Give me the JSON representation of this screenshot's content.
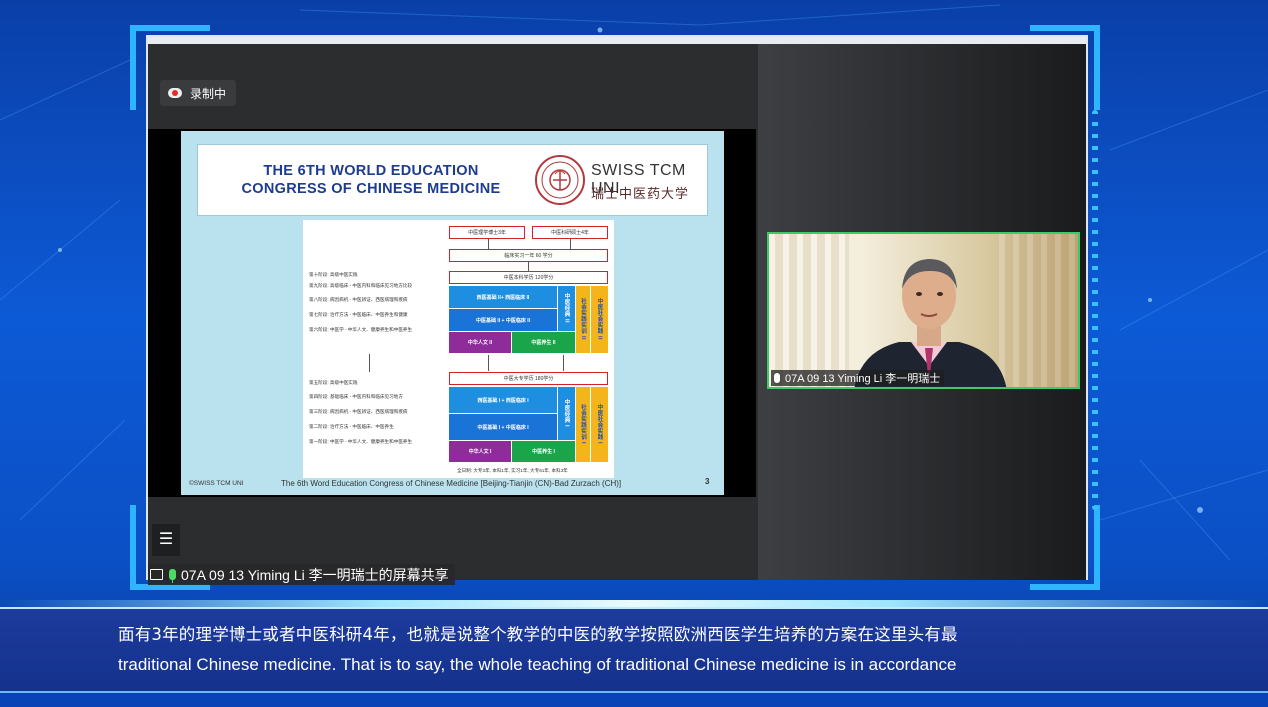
{
  "recording": {
    "label": "录制中"
  },
  "slide": {
    "title_line1": "THE 6TH WORLD EDUCATION",
    "title_line2": "CONGRESS OF CHINESE MEDICINE",
    "brand_en": "SWISS TCM UNI",
    "brand_cn": "瑞士中医药大学",
    "copyright": "©SWISS TCM UNI",
    "footer": "The 6th Word Education Congress of Chinese Medicine [Beijing-Tianjin (CN)-Bad Zurzach (CH)]",
    "page_number": "3",
    "diagram": {
      "top_box_1": "中医理学博士3年",
      "top_box_2": "中医科研硕士4年",
      "clinical_box": "临床实习一年 60 学分",
      "master_box": "中医本科学历 120学分",
      "bachelor_box": "中医大专学历 180学分",
      "row_west2": "西医基础 II+ 西医临床 II",
      "row_tcm2": "中医基础 II + 中医临床 II",
      "row_hum2": "中华人文 II",
      "row_health2": "中医养生 II",
      "row_west1": "西医基础 I + 西医临床 I",
      "row_tcm1": "中医基础 I + 中医临床 I",
      "row_hum1": "中华人文 I",
      "row_health1": "中医养生 I",
      "classic2": "中医经典 II",
      "practice2": "社会实践实训 II",
      "social2": "中医社会实践 II",
      "classic1": "中医经典 I",
      "practice1": "社会实践实训 I",
      "social1": "中医社会实践 I",
      "foot": "全日制: 大专3年, 本科1年, 实习1年, 大专61年, 本科3年",
      "stages_upper": [
        "第十阶段: 高级中医实践",
        "第九阶段: 高级临床 - 中医内科和临床见习地方比较",
        "第八阶段: 病因病机 - 中医辨证、西医病理和疾病",
        "第七阶段: 治疗方法 - 中医临床、中医养生和健康",
        "第六阶段: 中医学 - 中华人文、健康养生和中医养生"
      ],
      "stages_lower": [
        "第五阶段: 高级中医实践",
        "第四阶段: 基础临床 - 中医内科和临床见习地方",
        "第三阶段: 病因病机 - 中医辨证、西医病理和疾病",
        "第二阶段: 治疗方法 - 中医临床、中医养生",
        "第一阶段: 中医学 - 中华人文、健康养生和中医养生"
      ]
    }
  },
  "screen_share": {
    "caption": "07A 09 13 Yiming Li 李一明瑞士的屏幕共享"
  },
  "participant": {
    "label": "07A 09 13 Yiming Li 李一明瑞士"
  },
  "subtitles": {
    "chinese": "面有3年的理学博士或者中医科研4年，也就是说整个教学的中医的教学按照欧洲西医学生培养的方案在这里头有最",
    "english": "traditional Chinese medicine. That is to say, the whole teaching of traditional Chinese medicine is in accordance"
  },
  "colors": {
    "background": "#0d5ad6",
    "bracket": "#2fb4ff",
    "active_speaker_border": "#3ec96b",
    "title_blue": "#1d3c8f",
    "box_red": "#d2232a",
    "block_blue": "#1e8fe0",
    "block_purple": "#8e2c9a",
    "block_green": "#1aa54b",
    "block_orange": "#f3b51b"
  },
  "icons": [
    "cloud-record-icon",
    "menu-icon",
    "screen-share-icon",
    "mic-icon",
    "up-arrow-icon"
  ]
}
